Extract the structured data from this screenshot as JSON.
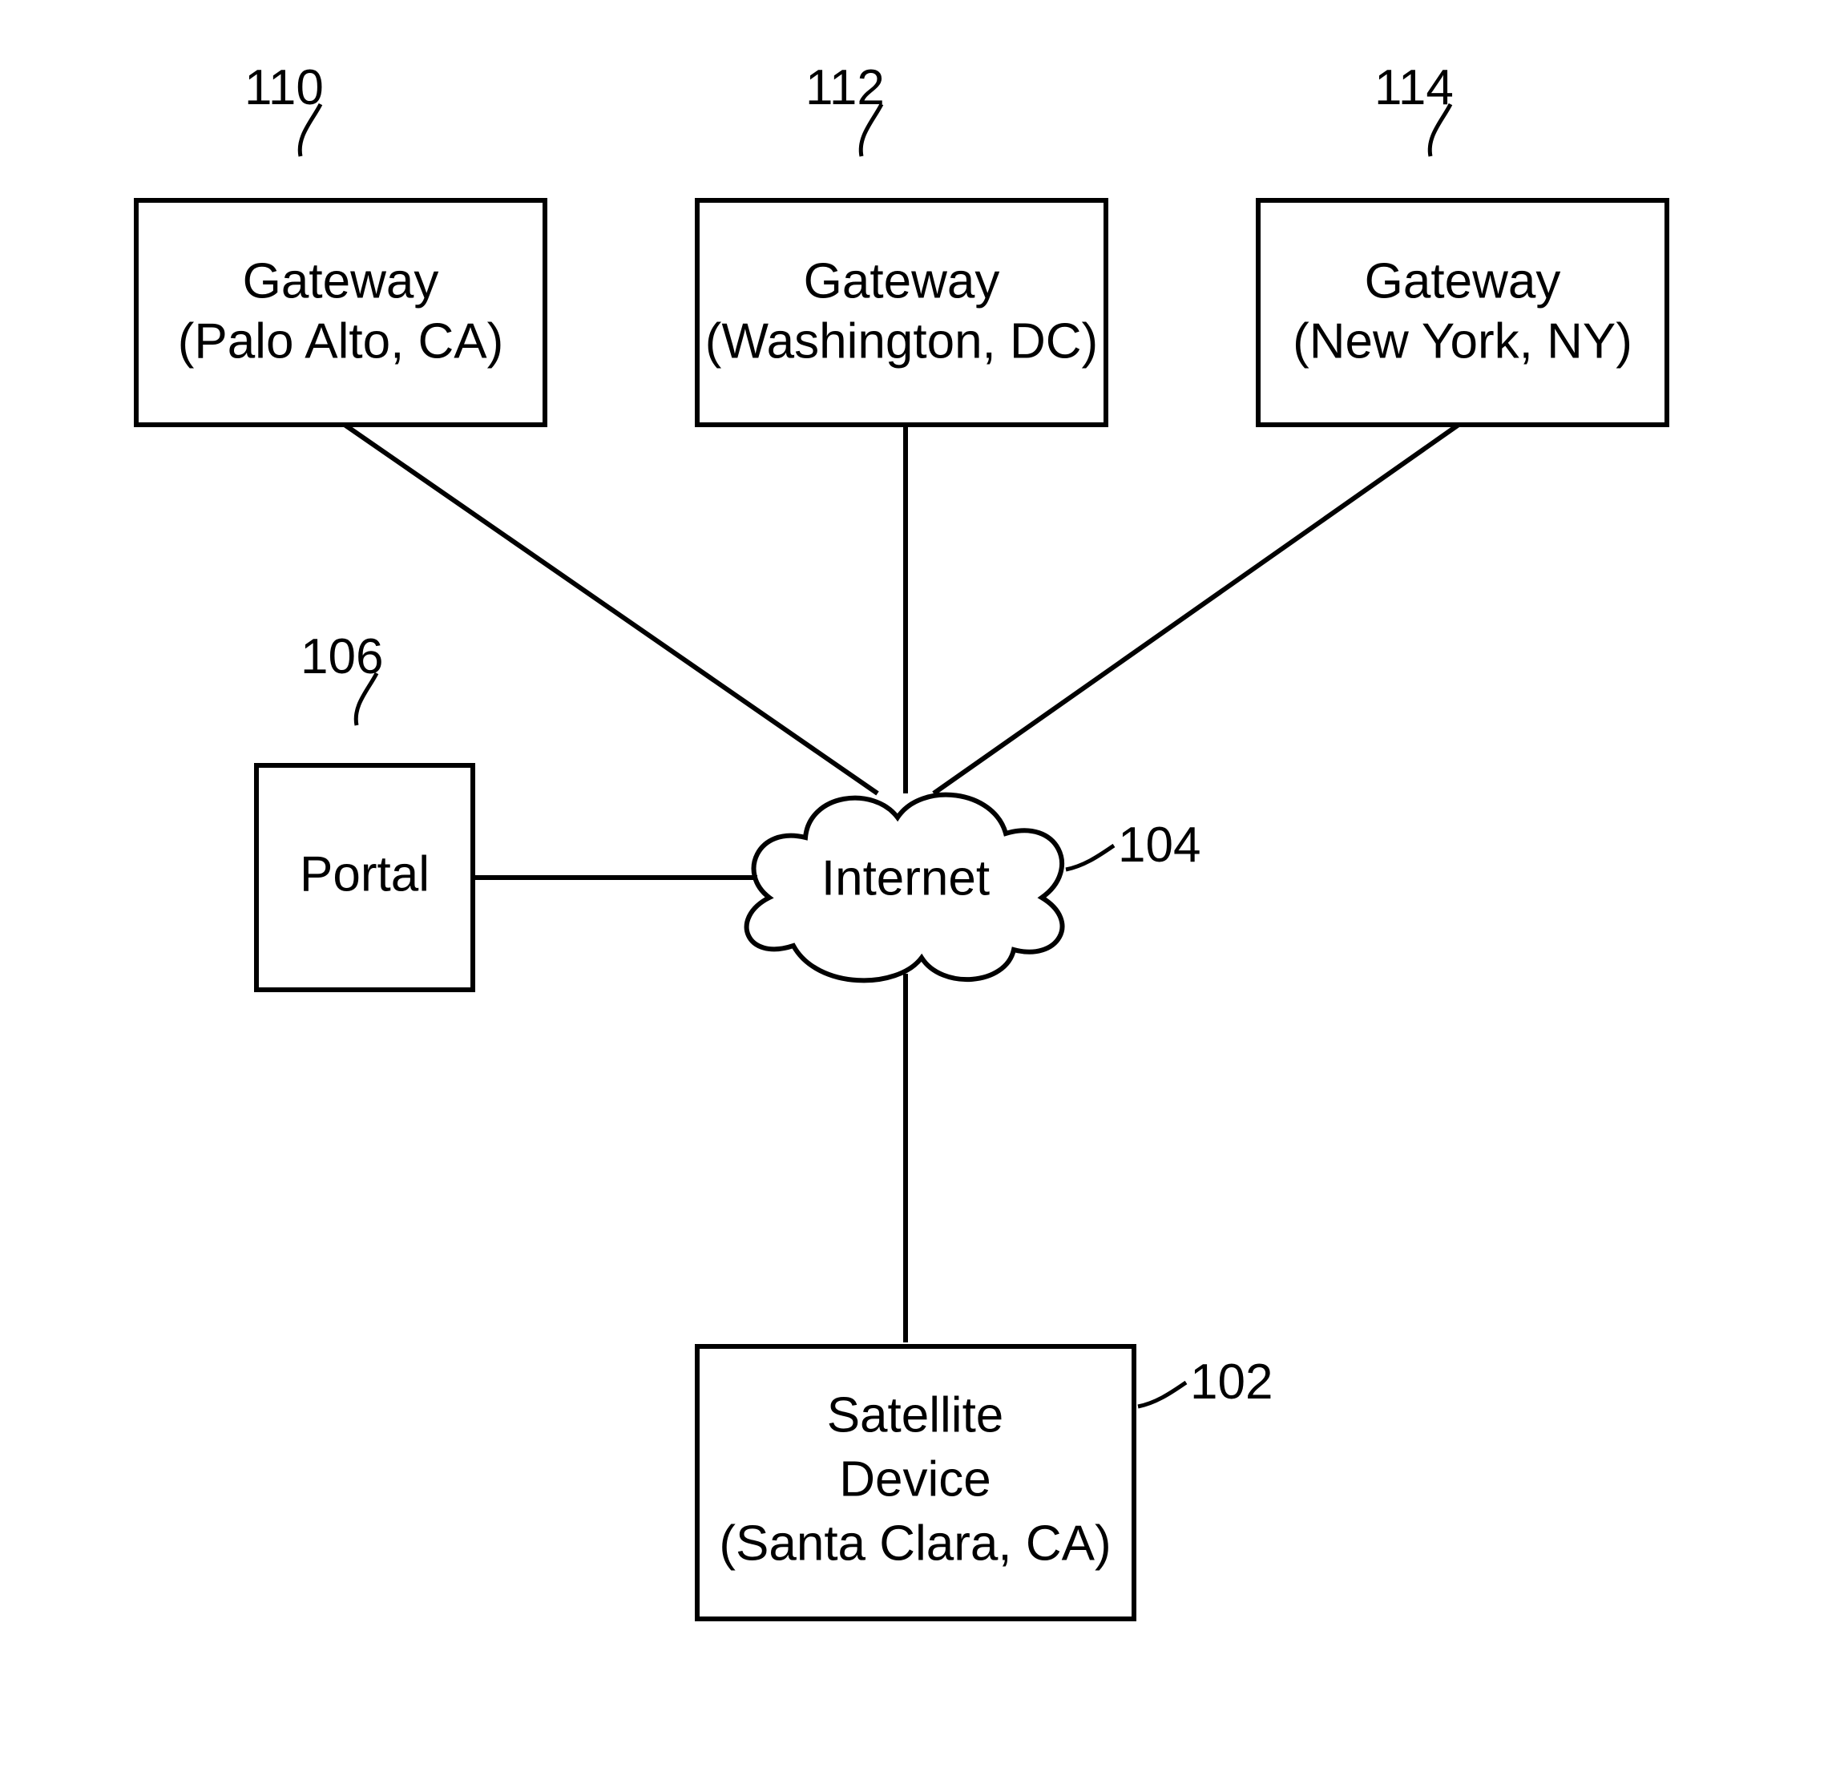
{
  "gateway1": {
    "ref": "110",
    "line1": "Gateway",
    "line2": "(Palo Alto, CA)"
  },
  "gateway2": {
    "ref": "112",
    "line1": "Gateway",
    "line2": "(Washington, DC)"
  },
  "gateway3": {
    "ref": "114",
    "line1": "Gateway",
    "line2": "(New York, NY)"
  },
  "portal": {
    "ref": "106",
    "label": "Portal"
  },
  "internet": {
    "ref": "104",
    "label": "Internet"
  },
  "device": {
    "ref": "102",
    "line1": "Satellite",
    "line2": "Device",
    "line3": "(Santa Clara, CA)"
  }
}
